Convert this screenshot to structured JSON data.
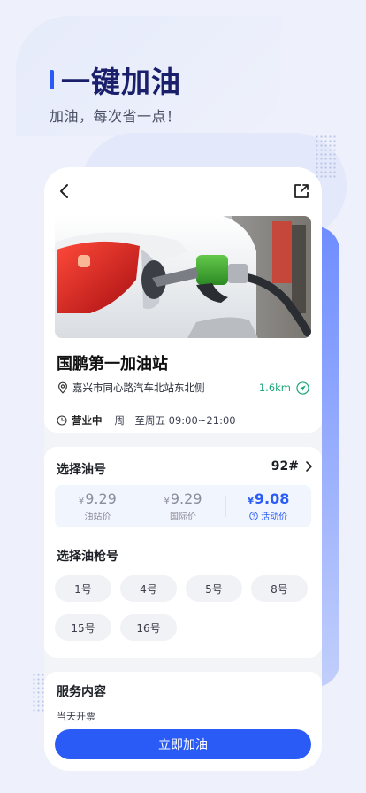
{
  "hero": {
    "title": "一键加油",
    "subtitle": "加油，每次省一点！"
  },
  "station": {
    "name": "国鹏第一加油站",
    "address": "嘉兴市同心路汽车北站东北侧",
    "distance": "1.6km",
    "status": "营业中",
    "hours": "周一至周五 09:00~21:00"
  },
  "fuel": {
    "section_title": "选择油号",
    "selected": "92#",
    "currency": "¥",
    "prices": [
      {
        "value": "9.29",
        "label": "油站价",
        "active": false
      },
      {
        "value": "9.29",
        "label": "国际价",
        "active": false
      },
      {
        "value": "9.08",
        "label": "活动价",
        "active": true
      }
    ]
  },
  "guns": {
    "section_title": "选择油枪号",
    "items": [
      "1号",
      "4号",
      "5号",
      "8号",
      "15号",
      "16号"
    ]
  },
  "service": {
    "section_title": "服务内容",
    "text": "当天开票",
    "cta": "立即加油"
  },
  "colors": {
    "accent": "#2a5bf7",
    "distance": "#1aa779",
    "title": "#1a1f6b"
  },
  "icons": [
    "back-arrow-icon",
    "share-icon",
    "location-pin-icon",
    "navigation-icon",
    "clock-icon",
    "chevron-right-icon",
    "question-icon"
  ]
}
